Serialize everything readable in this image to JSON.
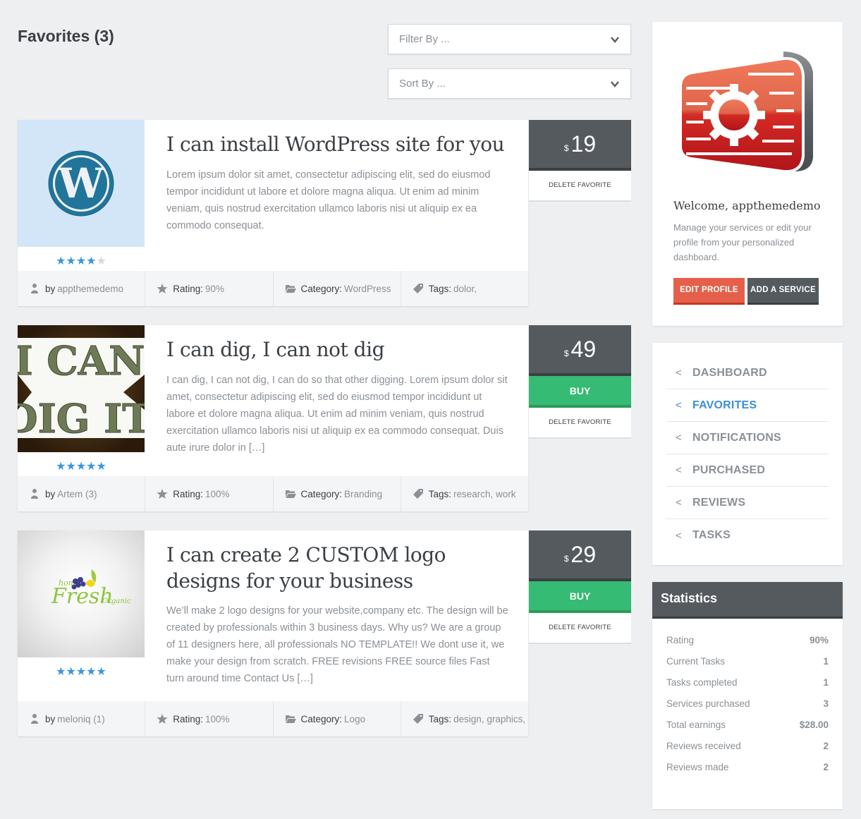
{
  "page": {
    "title": "Favorites (3)"
  },
  "filters": {
    "filter_placeholder": "Filter By ...",
    "sort_placeholder": "Sort By ..."
  },
  "services": [
    {
      "title": "I can install WordPress site for you",
      "description": "Lorem ipsum dolor sit amet, consectetur adipiscing elit, sed do eiusmod tempor incididunt ut labore et dolore magna aliqua. Ut enim ad minim veniam, quis nostrud exercitation ullamco laboris nisi ut aliquip ex ea commodo consequat.",
      "stars": 4,
      "stars_max": 5,
      "author_label": "by",
      "author": "appthemedemo",
      "rating_label": "Rating:",
      "rating": "90%",
      "category_label": "Category:",
      "category": "WordPress",
      "tags_label": "Tags:",
      "tags": "dolor,",
      "currency": "$",
      "price": "19",
      "buy_label": null,
      "delete_label": "DELETE FAVORITE",
      "thumb": "wordpress-logo"
    },
    {
      "title": "I can dig, I can not dig",
      "description": "I can dig, I can not dig, I can do so that other digging. Lorem ipsum dolor sit amet, consectetur adipiscing elit, sed do eiusmod tempor incididunt ut labore et dolore magna aliqua. Ut enim ad minim veniam, quis nostrud exercitation ullamco laboris nisi ut aliquip ex ea commodo consequat. Duis aute irure dolor in […]",
      "stars": 5,
      "stars_max": 5,
      "author_label": "by",
      "author": "Artem (3)",
      "rating_label": "Rating:",
      "rating": "100%",
      "category_label": "Category:",
      "category": "Branding",
      "tags_label": "Tags:",
      "tags": "research, work",
      "currency": "$",
      "price": "49",
      "buy_label": "BUY",
      "delete_label": "DELETE FAVORITE",
      "thumb": "i-can-dig-it-image"
    },
    {
      "title": "I can create 2 CUSTOM logo designs for your business",
      "description": "We’ll make 2 logo designs for your website,company etc. The design will be created by professionals within 3 business days.   Why us? We are a group of 11 designers here, all professionals NO TEMPLATE!! We dont use it, we make your design from scratch. FREE revisions FREE source files Fast turn around time Contact Us […]",
      "stars": 5,
      "stars_max": 5,
      "author_label": "by",
      "author": "meloniq (1)",
      "rating_label": "Rating:",
      "rating": "100%",
      "category_label": "Category:",
      "category": "Logo",
      "tags_label": "Tags:",
      "tags": "design, graphics,",
      "currency": "$",
      "price": "29",
      "buy_label": "BUY",
      "delete_label": "DELETE FAVORITE",
      "thumb": "home-fresh-organic-logo"
    }
  ],
  "profile": {
    "welcome": "Welcome, appthemedemo",
    "blurb": "Manage your services or edit your profile from your personalized dashboard.",
    "edit_profile_label": "EDIT PROFILE",
    "add_service_label": "ADD A SERVICE"
  },
  "nav": {
    "items": [
      {
        "label": "DASHBOARD",
        "active": false
      },
      {
        "label": "FAVORITES",
        "active": true
      },
      {
        "label": "NOTIFICATIONS",
        "active": false
      },
      {
        "label": "PURCHASED",
        "active": false
      },
      {
        "label": "REVIEWS",
        "active": false
      },
      {
        "label": "TASKS",
        "active": false
      }
    ]
  },
  "stats": {
    "title": "Statistics",
    "rows": [
      {
        "label": "Rating",
        "value": "90%"
      },
      {
        "label": "Current Tasks",
        "value": "1"
      },
      {
        "label": "Tasks completed",
        "value": "1"
      },
      {
        "label": "Services purchased",
        "value": "3"
      },
      {
        "label": "Total earnings",
        "value": "$28.00"
      },
      {
        "label": "Reviews received",
        "value": "2"
      },
      {
        "label": "Reviews made",
        "value": "2"
      }
    ]
  },
  "colors": {
    "accent_blue": "#3a8fd8",
    "buy_green": "#35bb73",
    "edit_red": "#e4604a",
    "dark_slate": "#555a5f"
  }
}
